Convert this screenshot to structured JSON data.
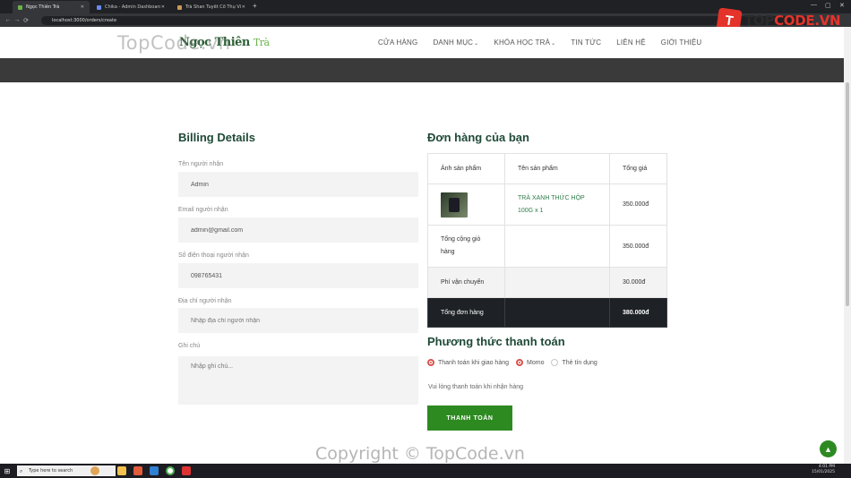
{
  "browser": {
    "tabs": [
      {
        "label": "Ngọc Thiên Trà",
        "color": "#6bb34b"
      },
      {
        "label": "Chika - Admin Dashboard Templ...",
        "color": "#6b8af0"
      },
      {
        "label": "Trà Shan Tuyết Cổ Thụ Việt Nam",
        "color": "#c89a5a"
      }
    ],
    "url": "localhost:3000/orders/create"
  },
  "brand_watermark": {
    "mark": "T",
    "text_a": "TOP",
    "text_b": "CODE.VN"
  },
  "watermark_top": "TopCode.vn",
  "watermark_bottom": "Copyright © TopCode.vn",
  "site": {
    "logo_a": "Ngọc Thiên",
    "logo_b": "Trà",
    "nav": [
      {
        "label": "CỬA HÀNG",
        "dropdown": false
      },
      {
        "label": "DANH MỤC",
        "dropdown": true
      },
      {
        "label": "KHÓA HỌC TRÀ",
        "dropdown": true
      },
      {
        "label": "TIN TỨC",
        "dropdown": false
      },
      {
        "label": "LIÊN HỆ",
        "dropdown": false
      },
      {
        "label": "GIỚI THIỆU",
        "dropdown": false
      }
    ]
  },
  "billing": {
    "title": "Billing Details",
    "fields": [
      {
        "label": "Tên người nhận",
        "value": "Admin",
        "placeholder": ""
      },
      {
        "label": "Email người nhận",
        "value": "admin@gmail.com",
        "placeholder": ""
      },
      {
        "label": "Số điện thoại người nhận",
        "value": "098765431",
        "placeholder": ""
      },
      {
        "label": "Địa chỉ người nhận",
        "value": "",
        "placeholder": "Nhập địa chỉ người nhận"
      },
      {
        "label": "Ghi chú",
        "value": "",
        "placeholder": "Nhập ghi chú..."
      }
    ]
  },
  "order": {
    "title": "Đơn hàng của bạn",
    "headers": [
      "Ảnh sản phẩm",
      "Tên sản phẩm",
      "Tổng giá"
    ],
    "item": {
      "name": "TRÀ XANH THỨC HỘP 100G x 1",
      "price": "350.000đ"
    },
    "subtotal": {
      "label": "Tổng cộng giỏ hàng",
      "value": "350.000đ"
    },
    "shipping": {
      "label": "Phí vận chuyển",
      "value": "30.000đ"
    },
    "total": {
      "label": "Tổng đơn hàng",
      "value": "380.000đ"
    }
  },
  "payment": {
    "title": "Phương thức thanh toán",
    "options": [
      {
        "label": "Thanh toán khi giao hàng",
        "selected": true
      },
      {
        "label": "Momo",
        "selected": true
      },
      {
        "label": "Thẻ tín dụng",
        "selected": false
      }
    ],
    "note": "Vui lòng thanh toán khi nhận hàng",
    "button": "THANH TOÁN"
  },
  "taskbar": {
    "search_placeholder": "Type here to search",
    "time": "4:01 PM",
    "date": "15/01/2025"
  }
}
